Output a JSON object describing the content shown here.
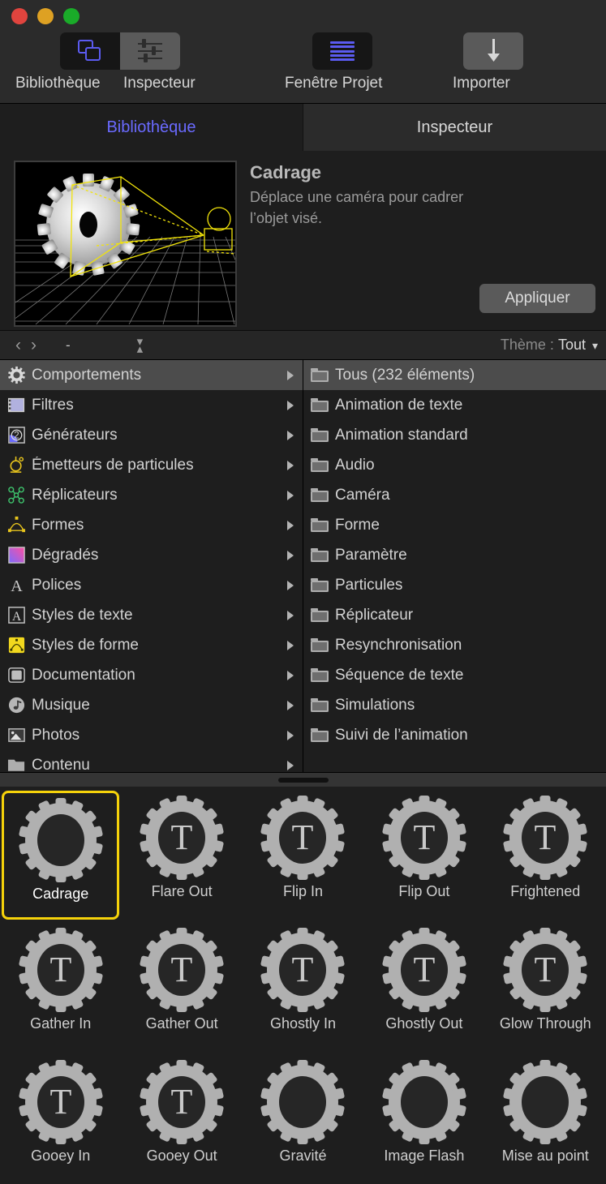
{
  "window": {
    "traffic_lights": [
      "close",
      "minimize",
      "zoom"
    ],
    "colors": {
      "accent_blue": "#5b5bf0",
      "selection_yellow": "#f5d20a",
      "bg": "#1e1e1e",
      "toolbar_bg": "#2b2b2b"
    }
  },
  "toolbar": {
    "items": [
      {
        "label": "Bibliothèque",
        "icon": "library-icon",
        "state": "on"
      },
      {
        "label": "Inspecteur",
        "icon": "sliders-icon",
        "state": "off"
      },
      {
        "label": "Fenêtre Projet",
        "icon": "project-lines-icon",
        "state": "on"
      },
      {
        "label": "Importer",
        "icon": "download-arrow-icon",
        "state": "off"
      }
    ]
  },
  "tabs": [
    {
      "label": "Bibliothèque",
      "active": true
    },
    {
      "label": "Inspecteur",
      "active": false
    }
  ],
  "preview": {
    "title": "Cadrage",
    "description": "Déplace une caméra pour cadrer l’objet visé.",
    "apply_label": "Appliquer",
    "thumbnail": "gear-camera-framing-preview"
  },
  "pathbar": {
    "back_icon": "chevron-left-icon",
    "forward_icon": "chevron-right-icon",
    "path_text": "-",
    "stepper_icon": "up-down-stepper-icon",
    "theme_label": "Thème :",
    "theme_value": "Tout",
    "theme_chevron": "chevron-down-icon"
  },
  "categories": [
    {
      "label": "Comportements",
      "icon": "gear-icon",
      "selected": true
    },
    {
      "label": "Filtres",
      "icon": "filmstrip-icon",
      "selected": false
    },
    {
      "label": "Générateurs",
      "icon": "generator-icon",
      "selected": false
    },
    {
      "label": "Émetteurs de particules",
      "icon": "particle-emitter-icon",
      "selected": false
    },
    {
      "label": "Réplicateurs",
      "icon": "replicator-icon",
      "selected": false
    },
    {
      "label": "Formes",
      "icon": "shapes-icon",
      "selected": false
    },
    {
      "label": "Dégradés",
      "icon": "gradient-icon",
      "selected": false
    },
    {
      "label": "Polices",
      "icon": "font-icon",
      "selected": false
    },
    {
      "label": "Styles de texte",
      "icon": "text-style-icon",
      "selected": false
    },
    {
      "label": "Styles de forme",
      "icon": "shape-style-icon",
      "selected": false
    },
    {
      "label": "Documentation",
      "icon": "documentation-icon",
      "selected": false
    },
    {
      "label": "Musique",
      "icon": "music-icon",
      "selected": false
    },
    {
      "label": "Photos",
      "icon": "photos-icon",
      "selected": false
    },
    {
      "label": "Contenu",
      "icon": "folder-icon",
      "selected": false
    }
  ],
  "subcategories": [
    {
      "label": "Tous (232 éléments)",
      "selected": true
    },
    {
      "label": "Animation de texte",
      "selected": false
    },
    {
      "label": "Animation standard",
      "selected": false
    },
    {
      "label": "Audio",
      "selected": false
    },
    {
      "label": "Caméra",
      "selected": false
    },
    {
      "label": "Forme",
      "selected": false
    },
    {
      "label": "Paramètre",
      "selected": false
    },
    {
      "label": "Particules",
      "selected": false
    },
    {
      "label": "Réplicateur",
      "selected": false
    },
    {
      "label": "Resynchronisation",
      "selected": false
    },
    {
      "label": "Séquence de texte",
      "selected": false
    },
    {
      "label": "Simulations",
      "selected": false
    },
    {
      "label": "Suivi de l’animation",
      "selected": false
    }
  ],
  "items": [
    {
      "label": "Cadrage",
      "glyph": "",
      "selected": true
    },
    {
      "label": "Flare Out",
      "glyph": "T",
      "selected": false
    },
    {
      "label": "Flip In",
      "glyph": "T",
      "selected": false
    },
    {
      "label": "Flip Out",
      "glyph": "T",
      "selected": false
    },
    {
      "label": "Frightened",
      "glyph": "T",
      "selected": false
    },
    {
      "label": "Gather In",
      "glyph": "T",
      "selected": false
    },
    {
      "label": "Gather Out",
      "glyph": "T",
      "selected": false
    },
    {
      "label": "Ghostly In",
      "glyph": "T",
      "selected": false
    },
    {
      "label": "Ghostly Out",
      "glyph": "T",
      "selected": false
    },
    {
      "label": "Glow Through",
      "glyph": "T",
      "selected": false
    },
    {
      "label": "Gooey In",
      "glyph": "T",
      "selected": false
    },
    {
      "label": "Gooey Out",
      "glyph": "T",
      "selected": false
    },
    {
      "label": "Gravité",
      "glyph": "",
      "selected": false
    },
    {
      "label": "Image Flash",
      "glyph": "",
      "selected": false
    },
    {
      "label": "Mise au point",
      "glyph": "",
      "selected": false
    }
  ]
}
